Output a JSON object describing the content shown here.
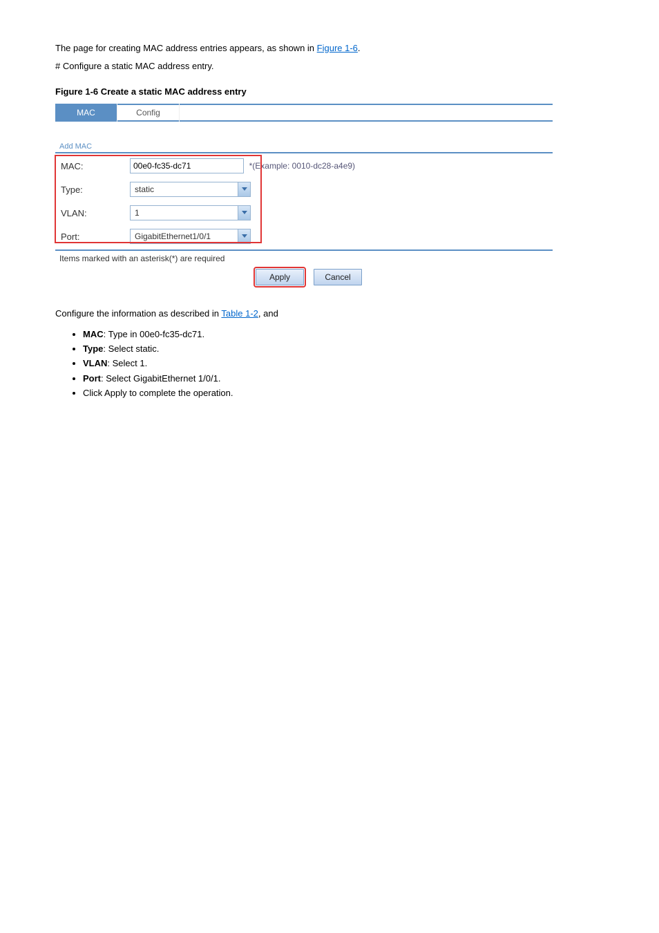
{
  "intro": {
    "line1_prefix": "The page for creating MAC address entries appears, as shown in ",
    "figure_link": "Figure 1-6",
    "line1_suffix": ".",
    "line2": "# Configure a static MAC address entry."
  },
  "figure": {
    "caption": "Figure 1-6 Create a static MAC address entry"
  },
  "screenshot": {
    "tabs": {
      "mac": "MAC",
      "config": "Config"
    },
    "panel_label": "Add MAC",
    "form": {
      "mac_label": "MAC:",
      "mac_value": "00e0-fc35-dc71",
      "mac_hint": "*(Example: 0010-dc28-a4e9)",
      "type_label": "Type:",
      "type_value": "static",
      "vlan_label": "VLAN:",
      "vlan_value": "1",
      "port_label": "Port:",
      "port_value": "GigabitEthernet1/0/1"
    },
    "required_note": "Items marked with an asterisk(*) are required",
    "buttons": {
      "apply": "Apply",
      "cancel": "Cancel"
    }
  },
  "post": {
    "step_line_prefix": "Configure the information as described in ",
    "step_link": "Table 1-2",
    "step_line_suffix": ", and",
    "bullets": [
      {
        "b": "MAC",
        "rest": ": Type in 00e0-fc35-dc71."
      },
      {
        "b": "Type",
        "rest": ": Select static."
      },
      {
        "b": "VLAN",
        "rest": ": Select 1."
      },
      {
        "b": "Port",
        "rest": ": Select GigabitEthernet 1/0/1."
      },
      {
        "b": "",
        "rest": "Click Apply to complete the operation."
      }
    ]
  }
}
